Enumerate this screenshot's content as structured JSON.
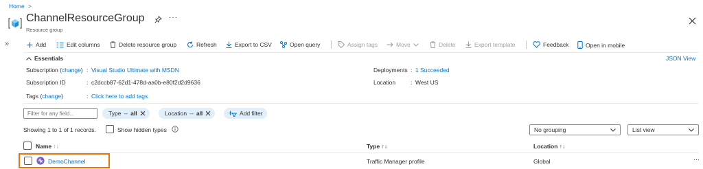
{
  "breadcrumb": {
    "home": "Home",
    "separator": ">"
  },
  "header": {
    "title": "ChannelResourceGroup",
    "subtitle": "Resource group",
    "more_glyph": "···",
    "icons": {
      "resource_group": "resource-group-icon",
      "pin": "pin-icon",
      "close": "close-icon"
    }
  },
  "sidebar": {
    "expand_glyph": "»"
  },
  "toolbar": {
    "add": "Add",
    "edit_columns": "Edit columns",
    "delete_group": "Delete resource group",
    "refresh": "Refresh",
    "export_csv": "Export to CSV",
    "open_query": "Open query",
    "assign_tags": "Assign tags",
    "move": "Move",
    "delete": "Delete",
    "export_template": "Export template",
    "feedback": "Feedback",
    "open_mobile": "Open in mobile"
  },
  "essentials": {
    "title": "Essentials",
    "json_view": "JSON View",
    "subscription_label": "Subscription",
    "change": "change",
    "subscription_value": "Visual Studio Ultimate with MSDN",
    "subscription_id_label": "Subscription ID",
    "subscription_id_value": "c2dccb87-62d1-478d-aa0b-e80f2d2d9636",
    "tags_label": "Tags",
    "tags_value": "Click here to add tags",
    "deployments_label": "Deployments",
    "deployments_value": "1 Succeeded",
    "location_label": "Location",
    "location_value": "West US",
    "colon": ":"
  },
  "filters": {
    "filter_placeholder": "Filter for any field...",
    "type_pill": {
      "name": "Type",
      "op": "--",
      "value": "all"
    },
    "location_pill": {
      "name": "Location",
      "op": "--",
      "value": "all"
    },
    "add_filter": "Add filter"
  },
  "list_controls": {
    "records": "Showing 1 to 1 of 1 records.",
    "show_hidden": "Show hidden types",
    "grouping": "No grouping",
    "view": "List view"
  },
  "table": {
    "columns": {
      "name": "Name",
      "type": "Type",
      "location": "Location",
      "sort_glyph": "↑↓",
      "name_sort_glyph": "↑↓"
    },
    "rows": [
      {
        "name": "DemoChannel",
        "type": "Traffic Manager profile",
        "location": "Global",
        "more": "···"
      }
    ]
  },
  "colors": {
    "accent": "#0078d4",
    "highlight_border": "#e8740c",
    "pill_bg": "#e1effa"
  }
}
